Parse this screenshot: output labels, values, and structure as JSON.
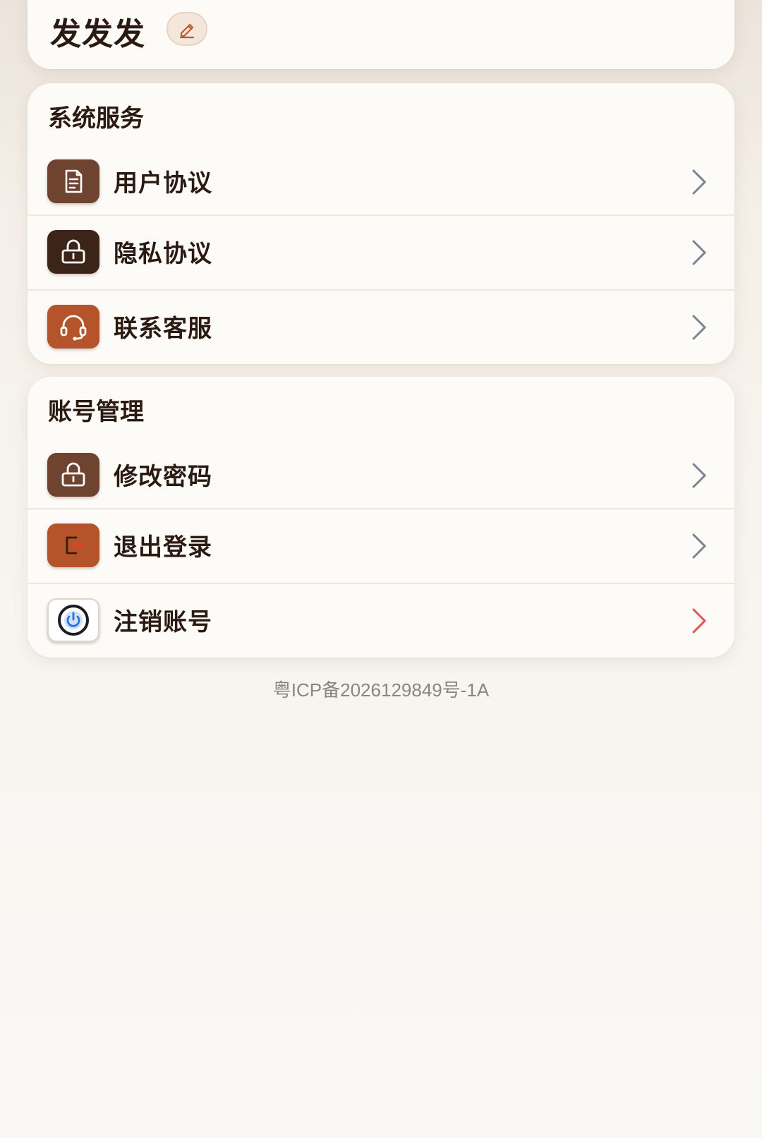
{
  "profile": {
    "name": "发发发",
    "edit_icon": "pencil-icon"
  },
  "sections": [
    {
      "title": "系统服务",
      "items": [
        {
          "label": "用户协议",
          "icon": "document-icon",
          "icon_bg": "#6e4330"
        },
        {
          "label": "隐私协议",
          "icon": "lock-icon",
          "icon_bg": "#3d2418"
        },
        {
          "label": "联系客服",
          "icon": "headset-icon",
          "icon_bg": "#b5532a"
        }
      ]
    },
    {
      "title": "账号管理",
      "items": [
        {
          "label": "修改密码",
          "icon": "lock-icon",
          "icon_bg": "#6e4330"
        },
        {
          "label": "退出登录",
          "icon": "logout-icon",
          "icon_bg": "#b5532a"
        },
        {
          "label": "注销账号",
          "icon": "power-icon",
          "icon_bg": "#ffffff"
        }
      ]
    }
  ],
  "footer": {
    "icp": "粤ICP备2026129849号-1A"
  },
  "colors": {
    "chevron": "#7a8390",
    "chevron_danger": "#e0544f",
    "accent": "#b5532a"
  }
}
